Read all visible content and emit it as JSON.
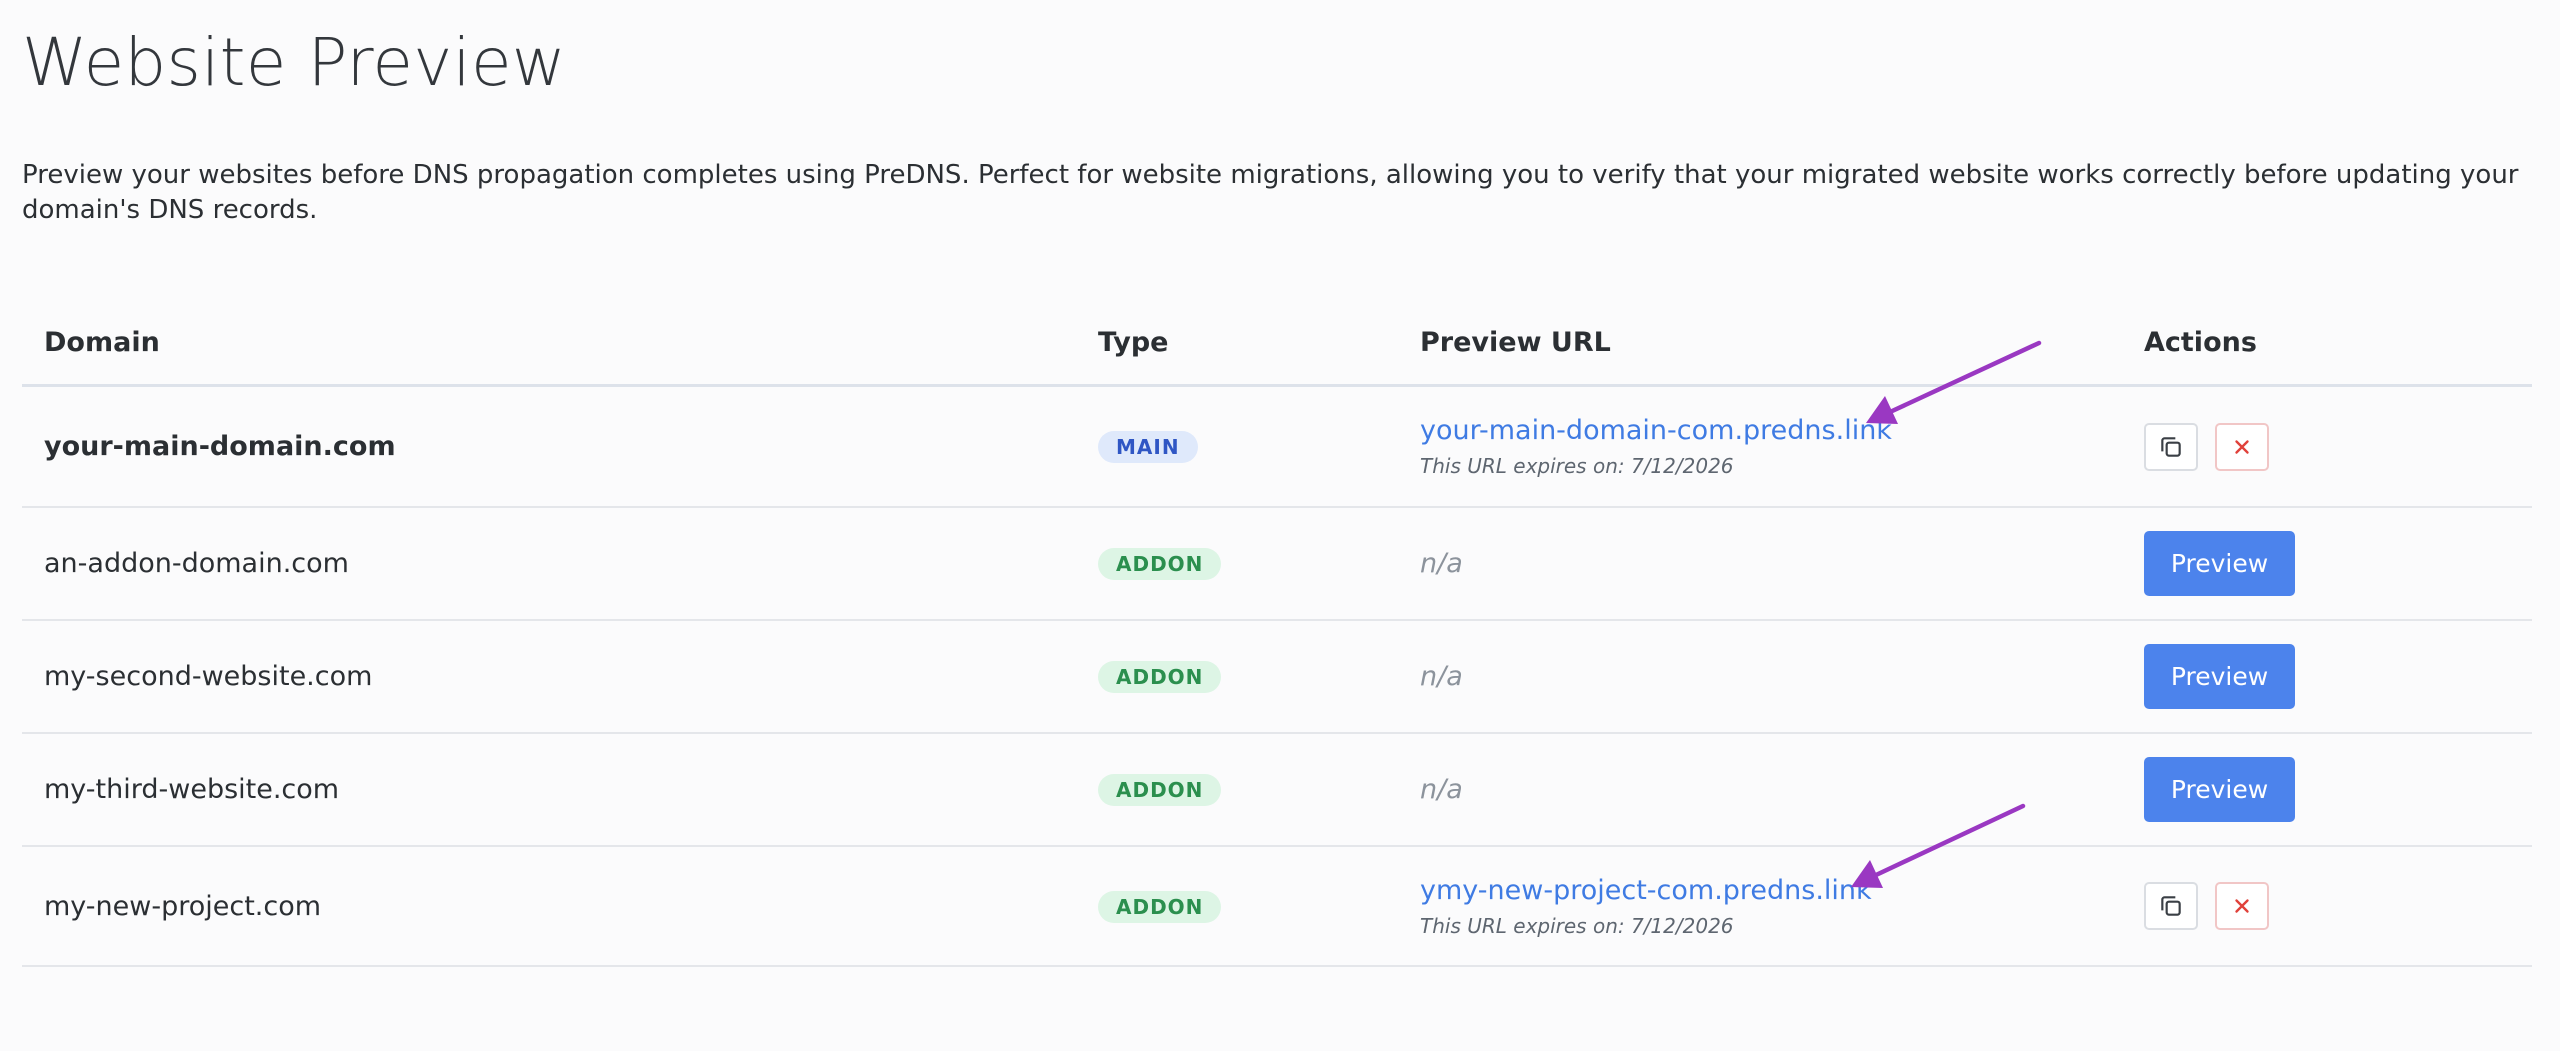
{
  "page": {
    "title": "Website Preview",
    "description": "Preview your websites before DNS propagation completes using PreDNS. Perfect for website migrations, allowing you to verify that your migrated website works correctly before updating your domain's DNS records."
  },
  "table": {
    "headers": {
      "domain": "Domain",
      "type": "Type",
      "preview_url": "Preview URL",
      "actions": "Actions"
    },
    "rows": [
      {
        "domain": "your-main-domain.com",
        "type": "MAIN",
        "preview_url": "your-main-domain-com.predns.link",
        "expiry": "This URL expires on: 7/12/2026"
      },
      {
        "domain": "an-addon-domain.com",
        "type": "ADDON",
        "preview_url": "n/a",
        "action_label": "Preview"
      },
      {
        "domain": "my-second-website.com",
        "type": "ADDON",
        "preview_url": "n/a",
        "action_label": "Preview"
      },
      {
        "domain": "my-third-website.com",
        "type": "ADDON",
        "preview_url": "n/a",
        "action_label": "Preview"
      },
      {
        "domain": "my-new-project.com",
        "type": "ADDON",
        "preview_url": "ymy-new-project-com.predns.link",
        "expiry": "This URL expires on: 7/12/2026"
      }
    ]
  },
  "icons": {
    "copy": "copy-icon",
    "remove": "close-icon"
  },
  "colors": {
    "link": "#3f7be3",
    "primary_button": "#4c83ec",
    "main_badge_bg": "#dfe9fb",
    "main_badge_text": "#2f56c4",
    "addon_badge_bg": "#ddf5e5",
    "addon_badge_text": "#2b8f4e",
    "remove_icon": "#e0413a",
    "annotation_arrow": "#9a38c2"
  }
}
